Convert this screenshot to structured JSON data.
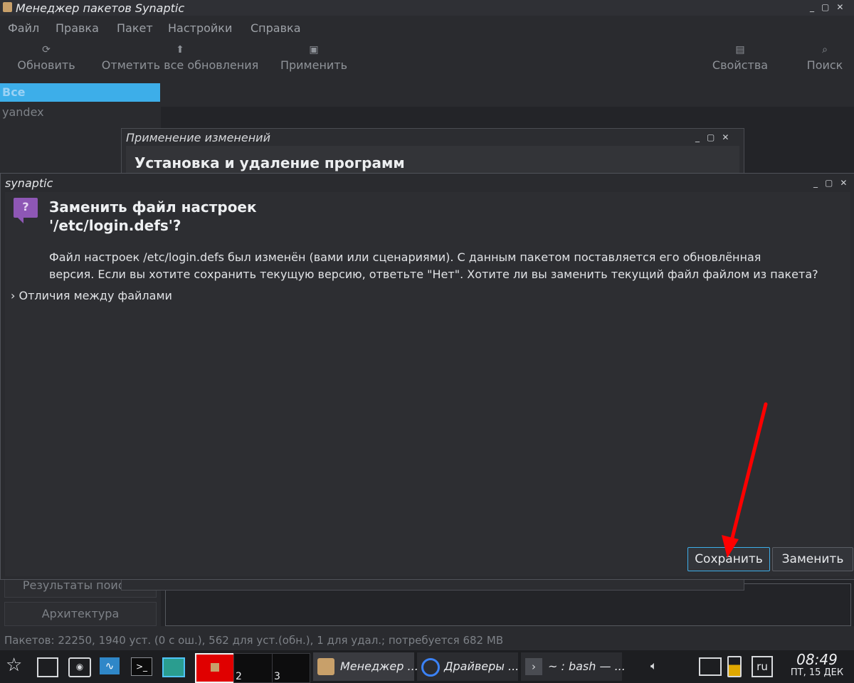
{
  "main_window": {
    "title": "Менеджер пакетов Synaptic",
    "menu": [
      "Файл",
      "Правка",
      "Пакет",
      "Настройки",
      "Справка"
    ],
    "toolbar": {
      "reload": "Обновить",
      "mark_all_upgrades": "Отметить все обновления",
      "apply": "Применить",
      "properties": "Свойства",
      "search": "Поиск"
    },
    "sidebar": {
      "items": [
        "Все",
        "yandex"
      ],
      "search_results": "Результаты поиска",
      "architecture": "Архитектура"
    },
    "status": "Пакетов: 22250, 1940 уст. (0 с ош.), 562 для уст.(обн.), 1 для удал.; потребуется 682 MB"
  },
  "apply_dialog": {
    "title": "Применение изменений",
    "header": "Установка и удаление программ"
  },
  "conffile_dialog": {
    "title": "synaptic",
    "heading_line1": "Заменить файл настроек",
    "heading_line2": "'/etc/login.defs'?",
    "message_line1": "Файл настроек /etc/login.defs был изменён (вами или сценариями). С данным пакетом поставляется его обновлённая",
    "message_line2": "версия. Если вы хотите сохранить текущую версию, ответьте \"Нет\". Хотите ли вы заменить текущий файл файлом из пакета?",
    "diff_expander": "Отличия между файлами",
    "save_button": "Сохранить",
    "replace_button": "Заменить"
  },
  "taskbar": {
    "desktops": [
      "2",
      "3"
    ],
    "tasks": [
      "Менеджер ...",
      "Драйверы ...",
      "~ : bash — ..."
    ],
    "keyboard_layout": "ru",
    "clock_time": "08:49",
    "clock_date": "ПТ, 15 ДЕК"
  },
  "colors": {
    "accent": "#3daee9",
    "annotation_arrow": "#ff0000"
  }
}
